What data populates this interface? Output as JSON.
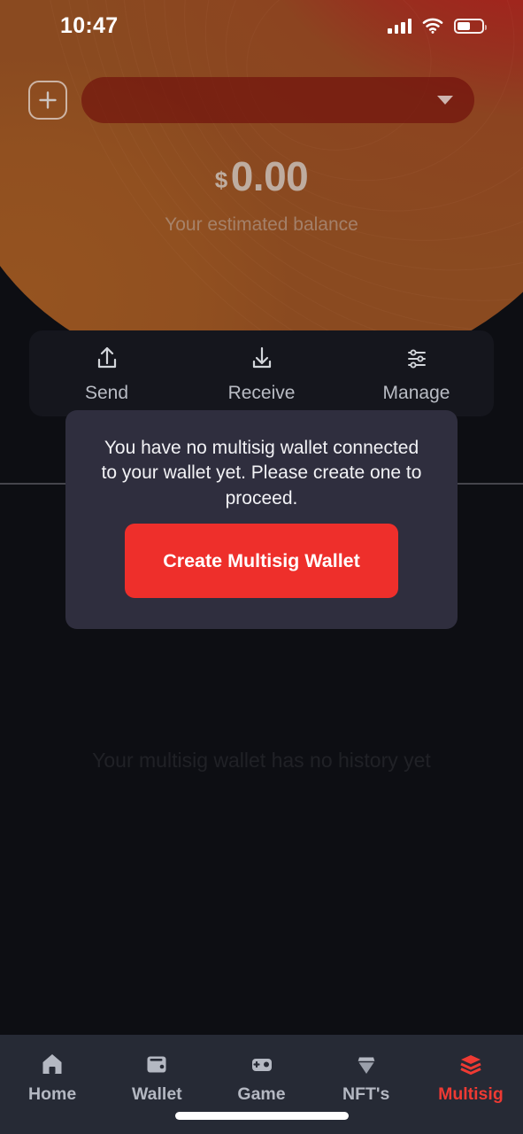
{
  "status_bar": {
    "time": "10:47",
    "signal_icon": "cellular-signal-icon",
    "wifi_icon": "wifi-icon",
    "battery_icon": "battery-icon",
    "battery_level_percent": 55
  },
  "header": {
    "add_button_icon": "plus-icon",
    "wallet_selector": {
      "value": "",
      "placeholder": "",
      "chevron_icon": "chevron-down-icon"
    }
  },
  "balance": {
    "currency_symbol": "$",
    "amount": "0.00",
    "caption": "Your estimated balance"
  },
  "actions": [
    {
      "label": "Send",
      "icon": "upload-arrow-icon"
    },
    {
      "label": "Receive",
      "icon": "download-arrow-icon"
    },
    {
      "label": "Manage",
      "icon": "sliders-icon"
    }
  ],
  "modal": {
    "message": "You have no multisig wallet connected to your wallet yet. Please create one to proceed.",
    "cta_label": "Create Multisig Wallet",
    "cta_color": "#ee2f2b",
    "background_color": "#2f2e3e"
  },
  "history": {
    "empty_text": "Your multisig wallet has no history yet"
  },
  "bottom_nav": {
    "active_color": "#ee3a33",
    "inactive_color": "#b4b8c2",
    "items": [
      {
        "label": "Home",
        "icon": "home-icon",
        "active": false
      },
      {
        "label": "Wallet",
        "icon": "wallet-icon",
        "active": false
      },
      {
        "label": "Game",
        "icon": "gamepad-icon",
        "active": false
      },
      {
        "label": "NFT's",
        "icon": "diamond-icon",
        "active": false
      },
      {
        "label": "Multisig",
        "icon": "layers-icon",
        "active": true
      }
    ]
  },
  "theme": {
    "gradient_from": "#8a4a20",
    "gradient_to": "#b31a17",
    "page_background": "#0d0e13",
    "action_bar_background": "#15161d",
    "nav_background": "#262a35"
  }
}
